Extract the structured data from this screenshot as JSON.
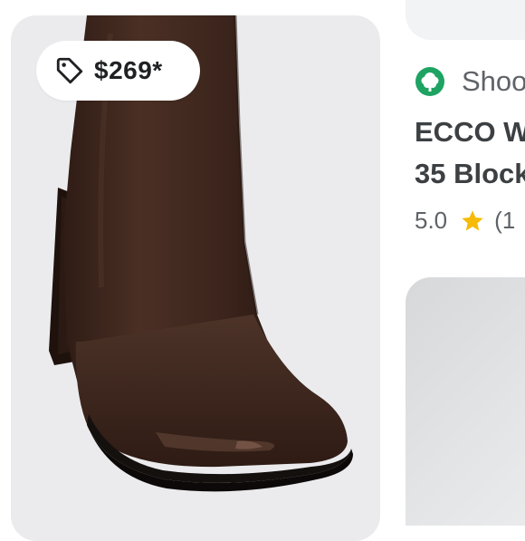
{
  "product_card": {
    "price": "$269*",
    "price_tag_icon": "tag-icon",
    "image_description_icon": "boot-image"
  },
  "listing": {
    "store_icon": "tree-logo-icon",
    "store_name": "Shoo",
    "title_line1": "ECCO W",
    "title_line2": "35 Block",
    "rating_value": "5.0",
    "rating_icon": "star-icon",
    "rating_count": "(1",
    "star_color": "#f6bb06",
    "store_icon_color": "#1ea362"
  }
}
